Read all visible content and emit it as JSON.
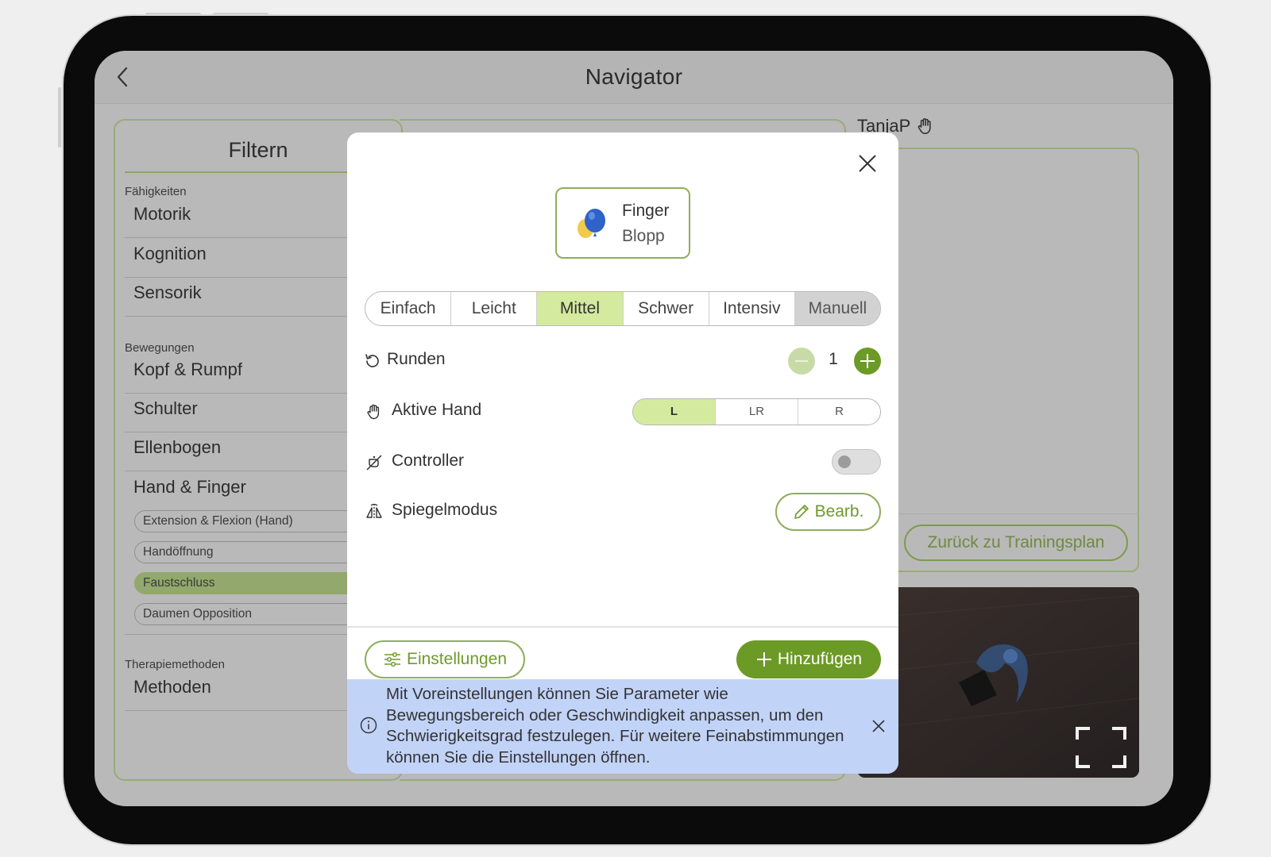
{
  "app": {
    "title": "Navigator",
    "user": "TanjaP"
  },
  "filter": {
    "title": "Filtern",
    "sections": [
      {
        "label": "Fähigkeiten",
        "items": [
          "Motorik",
          "Kognition",
          "Sensorik"
        ]
      },
      {
        "label": "Bewegungen",
        "items": [
          "Kopf & Rumpf",
          "Schulter",
          "Ellenbogen",
          "Hand & Finger"
        ]
      },
      {
        "label": "Therapiemethoden",
        "items": [
          "Methoden"
        ]
      }
    ],
    "chips": [
      "Extension & Flexion (Hand)",
      "Handöffnung",
      "Faustschluss",
      "Daumen Opposition"
    ],
    "active_chip": "Faustschluss"
  },
  "right": {
    "back_to_plan": "Zurück zu Trainingsplan"
  },
  "modal": {
    "game": {
      "line1": "Finger",
      "line2": "Blopp",
      "icon": "balloon-icon"
    },
    "levels": [
      "Einfach",
      "Leicht",
      "Mittel",
      "Schwer",
      "Intensiv",
      "Manuell"
    ],
    "selected_level": "Mittel",
    "rounds": {
      "label": "Runden",
      "value": "1"
    },
    "active_hand": {
      "label": "Aktive Hand",
      "options": [
        "L",
        "LR",
        "R"
      ],
      "selected": "L"
    },
    "controller": {
      "label": "Controller",
      "enabled": false
    },
    "mirror": {
      "label": "Spiegelmodus",
      "edit_label": "Bearb."
    },
    "settings_label": "Einstellungen",
    "add_label": "Hinzufügen",
    "info": "Mit Voreinstellungen können Sie Parameter wie Bewegungsbereich oder Geschwindigkeit anpassen, um den Schwierigkeitsgrad festzulegen. Für weitere Feinabstimmungen können Sie die Einstellungen öffnen."
  },
  "colors": {
    "accent": "#6c9a26",
    "accent_light": "#d4ea9f",
    "info_bg": "#c2d3f8",
    "overlay_gray": "#b9b9b9"
  }
}
